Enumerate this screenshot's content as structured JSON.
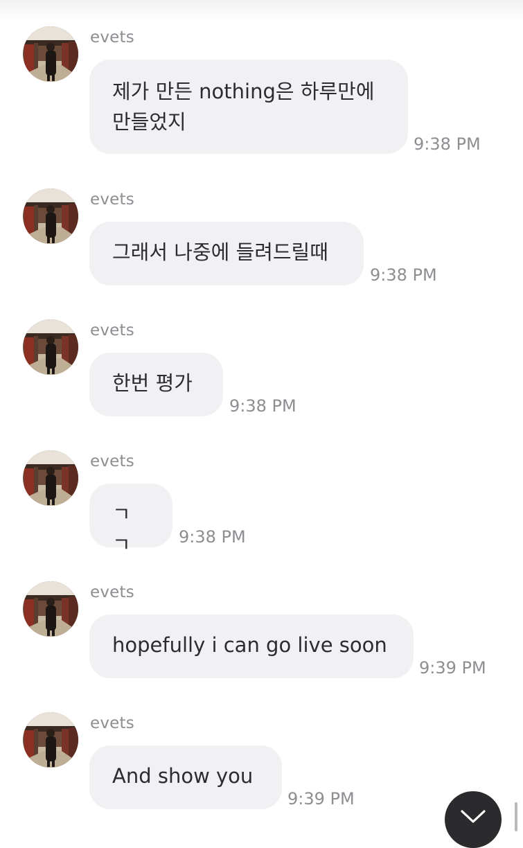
{
  "chat": {
    "messages": [
      {
        "sender": "evets",
        "text": "제가 만든 nothing은 하루만에\n만들었지",
        "time": "9:38 PM"
      },
      {
        "sender": "evets",
        "text": "그래서 나중에 들려드릴때",
        "time": "9:38 PM"
      },
      {
        "sender": "evets",
        "text": "한번 평가",
        "time": "9:38 PM"
      },
      {
        "sender": "evets",
        "text": "ㄱㄱ",
        "time": "9:38 PM"
      },
      {
        "sender": "evets",
        "text": "hopefully i can go live soon",
        "time": "9:39 PM"
      },
      {
        "sender": "evets",
        "text": "And show you",
        "time": "9:39 PM"
      }
    ]
  },
  "controls": {
    "scroll_down_icon": "chevron-down-icon"
  },
  "colors": {
    "bubble_bg": "#f1f1f4",
    "text": "#2c2c2e",
    "meta_text": "#8d8d92",
    "scroll_button_bg": "#2b2b2e"
  }
}
